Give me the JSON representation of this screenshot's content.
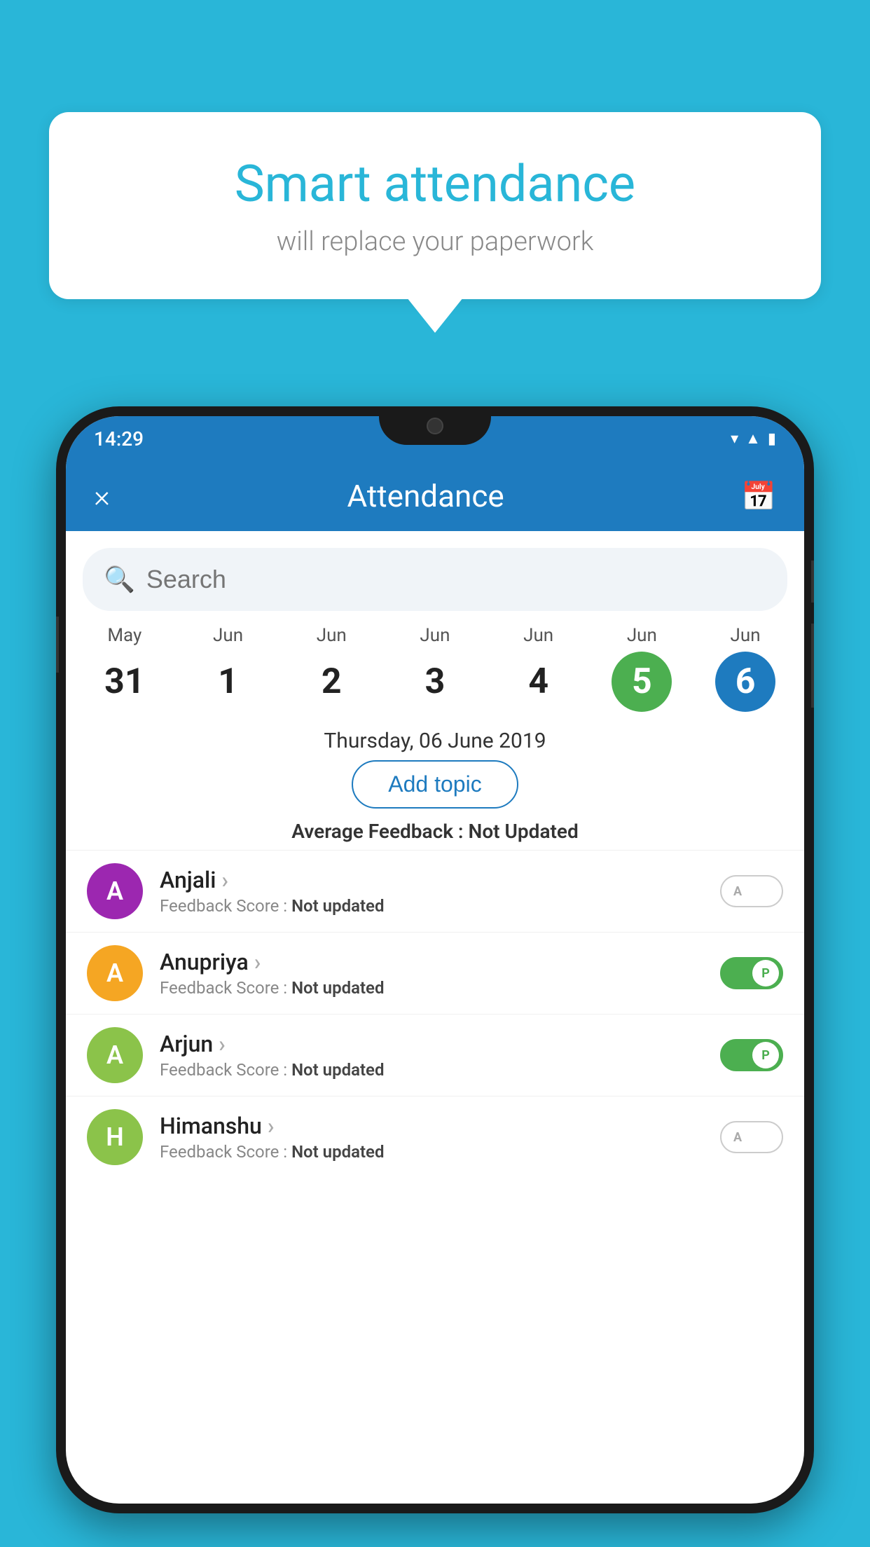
{
  "background_color": "#29b6d8",
  "bubble": {
    "title": "Smart attendance",
    "subtitle": "will replace your paperwork"
  },
  "status_bar": {
    "time": "14:29",
    "icons": [
      "wifi",
      "signal",
      "battery"
    ]
  },
  "header": {
    "title": "Attendance",
    "close_label": "×",
    "calendar_icon": "📅"
  },
  "search": {
    "placeholder": "Search"
  },
  "calendar": {
    "days": [
      {
        "month": "May",
        "num": "31",
        "state": "normal"
      },
      {
        "month": "Jun",
        "num": "1",
        "state": "normal"
      },
      {
        "month": "Jun",
        "num": "2",
        "state": "normal"
      },
      {
        "month": "Jun",
        "num": "3",
        "state": "normal"
      },
      {
        "month": "Jun",
        "num": "4",
        "state": "normal"
      },
      {
        "month": "Jun",
        "num": "5",
        "state": "today"
      },
      {
        "month": "Jun",
        "num": "6",
        "state": "selected"
      }
    ]
  },
  "selected_date": "Thursday, 06 June 2019",
  "add_topic_label": "Add topic",
  "avg_feedback_label": "Average Feedback :",
  "avg_feedback_value": "Not Updated",
  "students": [
    {
      "name": "Anjali",
      "avatar_letter": "A",
      "avatar_color": "#9c27b0",
      "feedback_label": "Feedback Score :",
      "feedback_value": "Not updated",
      "toggle": "off",
      "toggle_letter": "A"
    },
    {
      "name": "Anupriya",
      "avatar_letter": "A",
      "avatar_color": "#f5a623",
      "feedback_label": "Feedback Score :",
      "feedback_value": "Not updated",
      "toggle": "on",
      "toggle_letter": "P"
    },
    {
      "name": "Arjun",
      "avatar_letter": "A",
      "avatar_color": "#8bc34a",
      "feedback_label": "Feedback Score :",
      "feedback_value": "Not updated",
      "toggle": "on",
      "toggle_letter": "P"
    },
    {
      "name": "Himanshu",
      "avatar_letter": "H",
      "avatar_color": "#8bc34a",
      "feedback_label": "Feedback Score :",
      "feedback_value": "Not updated",
      "toggle": "off",
      "toggle_letter": "A"
    }
  ]
}
